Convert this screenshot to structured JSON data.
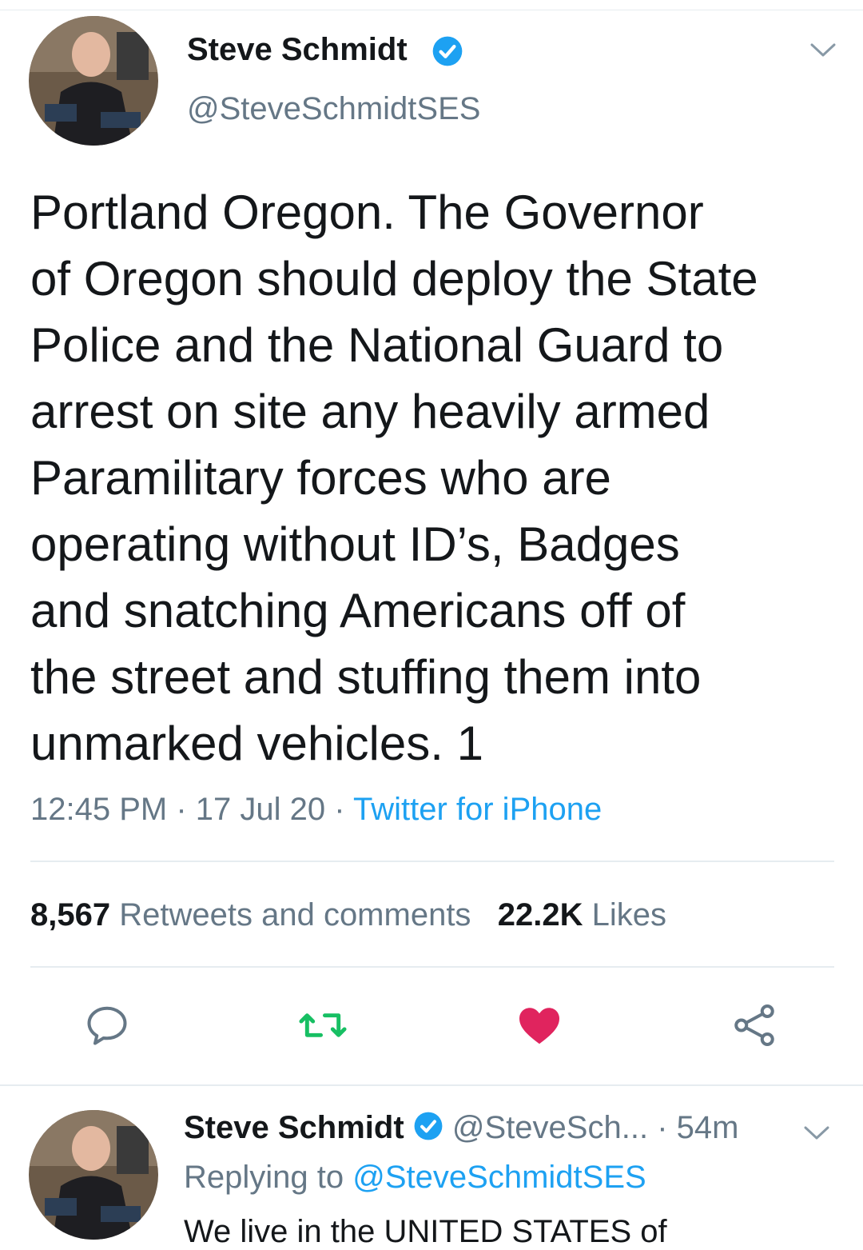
{
  "tweet": {
    "author_name": "Steve Schmidt",
    "author_handle": "@SteveSchmidtSES",
    "text": "Portland Oregon.  The Governor\nof Oregon should deploy the State\nPolice and the National Guard to\narrest on site any heavily armed\nParamilitary forces who are\noperating without ID’s, Badges\nand snatching Americans off of\nthe street and stuffing them into\nunmarked vehicles. 1",
    "time": "12:45 PM",
    "date": "17 Jul 20",
    "separator": "·",
    "source": "Twitter for iPhone",
    "retweets_count": "8,567",
    "retweets_label": "Retweets and comments",
    "likes_count": "22.2K",
    "likes_label": "Likes"
  },
  "reply": {
    "author_name": "Steve Schmidt",
    "author_handle": "@SteveSch...",
    "time_sep": "·",
    "time": "54m",
    "replying_prefix": "Replying to",
    "replying_to": "@SteveSchmidtSES",
    "text_partial": "We live in the UNITED STATES of"
  },
  "icons": {
    "verified": "verified-badge-icon",
    "chevron": "chevron-down-icon",
    "reply": "reply-icon",
    "retweet": "retweet-icon",
    "like": "heart-icon",
    "share": "share-icon"
  },
  "colors": {
    "accent": "#1da1f2",
    "retweet": "#17bf63",
    "like": "#e0245e",
    "secondary_text": "#657786"
  }
}
